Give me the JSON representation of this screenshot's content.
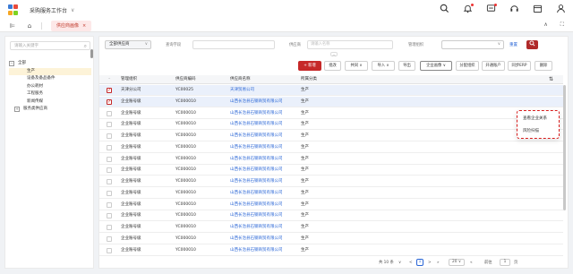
{
  "app": {
    "workspace_title": "采购服务工作台",
    "logo_colors": [
      "#3a7bd5",
      "#e94b3c",
      "#f5a623",
      "#7ed321"
    ]
  },
  "top_icons": [
    "search-icon",
    "notification-bell-icon",
    "message-icon",
    "headset-icon",
    "calendar-icon",
    "user-icon"
  ],
  "tabbar": {
    "active_tab": "供应商画像",
    "right_icons": [
      "collapse-up-icon",
      "fullscreen-icon"
    ]
  },
  "sidebar": {
    "search_placeholder": "请输入关键字",
    "tree": {
      "root": "全部",
      "root_toggle": "−",
      "children": [
        {
          "label": "生产",
          "selected": true
        },
        {
          "label": "设备及备品备件",
          "selected": false
        },
        {
          "label": "办公耗材",
          "selected": false
        },
        {
          "label": "工程服务",
          "selected": false
        },
        {
          "label": "新闻传媒",
          "selected": false
        }
      ],
      "extra": {
        "label": "服务类供应商",
        "toggle": "+"
      }
    }
  },
  "filters": {
    "scope_select": "全部供应商",
    "search_label": "查询字段",
    "supplier_label": "供应商",
    "supplier_placeholder": "请输入名称",
    "org_label": "管理组织",
    "reset_label": "重置",
    "search_button": "Q"
  },
  "toolbar": {
    "add": "+ 新增",
    "batch": "批改",
    "share": "共同",
    "import": "导入",
    "export": "导出",
    "enterprise_view": "企业画像",
    "assign_org": "分配组织",
    "open_account": "开通账户",
    "sync_erp": "同步ERP",
    "delete": "删除"
  },
  "table": {
    "columns": [
      "管理组织",
      "供应商编码",
      "供应商名称",
      "所属分类"
    ],
    "rows": [
      {
        "checked": true,
        "org": "天津分公司",
        "code": "YC00025",
        "name": "天津贸易公司",
        "category": "生产"
      },
      {
        "checked": true,
        "org": "企业账号级",
        "code": "YC000010",
        "name": "山西长治县石钢商贸有限公司",
        "category": "生产"
      },
      {
        "checked": false,
        "org": "企业账号级",
        "code": "YC000010",
        "name": "山西长治县石钢商贸有限公司",
        "category": "生产"
      },
      {
        "checked": false,
        "org": "企业账号级",
        "code": "YC000010",
        "name": "山西长治县石钢商贸有限公司",
        "category": "生产"
      },
      {
        "checked": false,
        "org": "企业账号级",
        "code": "YC000010",
        "name": "山西长治县石钢商贸有限公司",
        "category": "生产"
      },
      {
        "checked": false,
        "org": "企业账号级",
        "code": "YC000010",
        "name": "山西长治县石钢商贸有限公司",
        "category": "生产"
      },
      {
        "checked": false,
        "org": "企业账号级",
        "code": "YC000010",
        "name": "山西长治县石钢商贸有限公司",
        "category": "生产"
      },
      {
        "checked": false,
        "org": "企业账号级",
        "code": "YC000010",
        "name": "山西长治县石钢商贸有限公司",
        "category": "生产"
      },
      {
        "checked": false,
        "org": "企业账号级",
        "code": "YC000010",
        "name": "山西长治县石钢商贸有限公司",
        "category": "生产"
      },
      {
        "checked": false,
        "org": "企业账号级",
        "code": "YC000010",
        "name": "山西长治县石钢商贸有限公司",
        "category": "生产"
      },
      {
        "checked": false,
        "org": "企业账号级",
        "code": "YC000010",
        "name": "山西长治县石钢商贸有限公司",
        "category": "生产"
      },
      {
        "checked": false,
        "org": "企业账号级",
        "code": "YC000010",
        "name": "山西长治县石钢商贸有限公司",
        "category": "生产"
      },
      {
        "checked": false,
        "org": "企业账号级",
        "code": "YC000010",
        "name": "山西长治县石钢商贸有限公司",
        "category": "生产"
      },
      {
        "checked": false,
        "org": "企业账号级",
        "code": "YC000010",
        "name": "山西长治县石钢商贸有限公司",
        "category": "生产"
      },
      {
        "checked": false,
        "org": "企业账号级",
        "code": "YC000010",
        "name": "山西长治县石钢商贸有限公司",
        "category": "生产"
      }
    ]
  },
  "pagination": {
    "total": "共 10 条",
    "prev": "<",
    "current_page": "1",
    "next": ">",
    "more": "»",
    "page_size": "20",
    "goto_label": "前往",
    "goto_value": "1",
    "page_suffix": "页"
  },
  "popup": {
    "items": [
      "查看企业关系",
      "风险扫描"
    ]
  },
  "colors": {
    "accent": "#c62828",
    "link": "#2a66d6"
  }
}
